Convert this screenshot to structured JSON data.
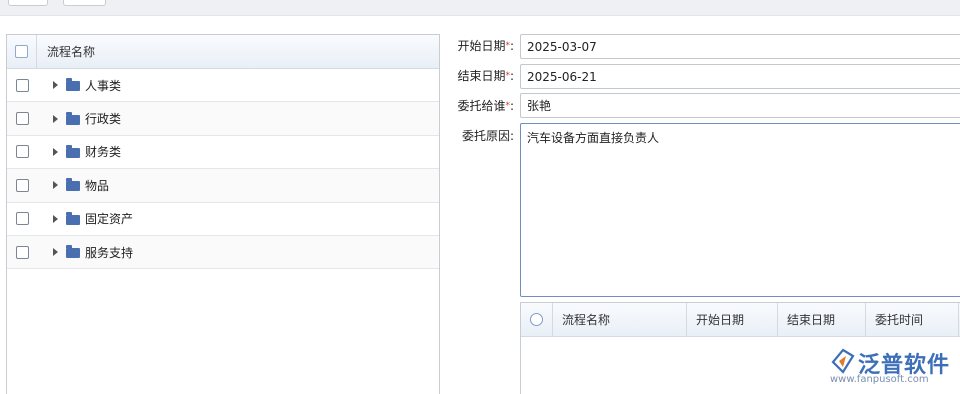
{
  "toolbar": {
    "buttons": [
      "",
      ""
    ]
  },
  "tree": {
    "header": "流程名称",
    "items": [
      {
        "label": "人事类"
      },
      {
        "label": "行政类"
      },
      {
        "label": "财务类"
      },
      {
        "label": "物品"
      },
      {
        "label": "固定资产"
      },
      {
        "label": "服务支持"
      }
    ]
  },
  "form": {
    "start_date_label": "开始日期",
    "start_date_value": "2025-03-07",
    "end_date_label": "结束日期",
    "end_date_value": "2025-06-21",
    "delegate_label": "委托给谁",
    "delegate_value": "张艳",
    "reason_label": "委托原因:",
    "reason_value": "汽车设备方面直接负责人",
    "required_mark": "*",
    "colon": ":"
  },
  "sub_grid": {
    "columns": [
      "流程名称",
      "开始日期",
      "结束日期",
      "委托时间"
    ]
  },
  "logo": {
    "name": "泛普软件",
    "url": "www.fanpusoft.com"
  },
  "colors": {
    "accent": "#3d6fb8",
    "folder": "#4a6fb0",
    "required": "#dd3333"
  }
}
